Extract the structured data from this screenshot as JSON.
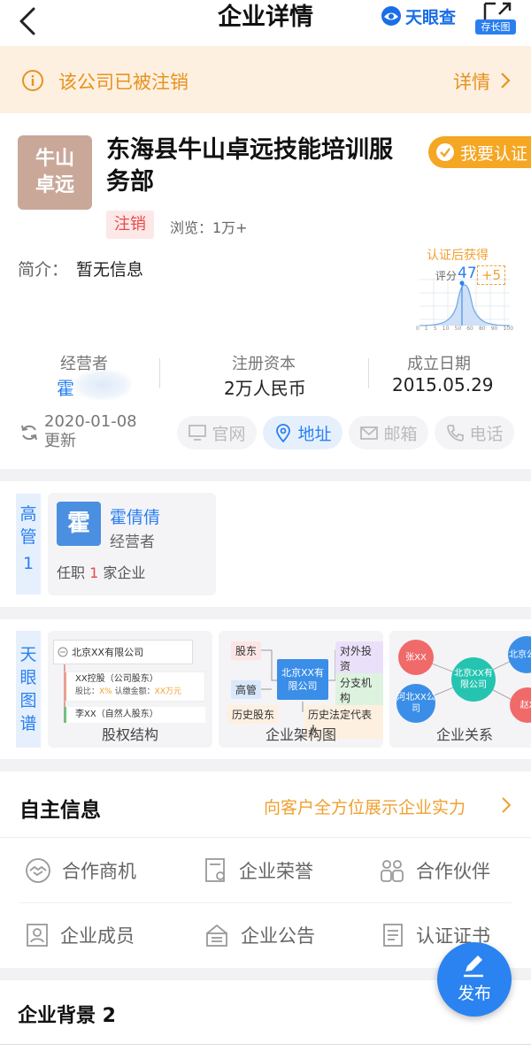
{
  "header": {
    "title": "企业详情",
    "brand": "天眼查",
    "long_image_label": "存长图"
  },
  "banner": {
    "text": "该公司已被注销",
    "link": "详情"
  },
  "company": {
    "logo_line1": "牛山",
    "logo_line2": "卓远",
    "name": "东海县牛山卓远技能培训服务部",
    "cert_button": "我要认证",
    "status": "注销",
    "views": "浏览：1万+",
    "intro_label": "简介：",
    "intro_value": "暂无信息"
  },
  "score_widget": {
    "head": "认证后获得",
    "label": "评分",
    "value": "47",
    "plus": "+5",
    "ticks": [
      "0",
      "1",
      "5",
      "10",
      "50",
      "60",
      "80",
      "90",
      "100"
    ]
  },
  "stats": {
    "operator_label": "经营者",
    "operator_value": "霍",
    "capital_label": "注册资本",
    "capital_value": "2万人民币",
    "date_label": "成立日期",
    "date_value": "2015.05.29"
  },
  "update": {
    "date": "2020-01-08",
    "label": "更新"
  },
  "contacts": {
    "website": "官网",
    "address": "地址",
    "email": "邮箱",
    "phone": "电话"
  },
  "executives": {
    "tag": "高管",
    "count": "1",
    "avatar": "霍",
    "name": "霍倩倩",
    "role": "经营者",
    "post_prefix": "任职",
    "post_count": "1",
    "post_suffix": "家企业"
  },
  "graphs": {
    "tag": "天眼图谱",
    "equity": {
      "label": "股权结构",
      "company": "北京XX有限公司",
      "holder1": "XX控股（公司股东）",
      "ratio_label": "股比：",
      "ratio_value": "X%",
      "paid_label": "认缴金额：",
      "paid_value": "XX万元",
      "holder2": "李XX（自然人股东）"
    },
    "structure": {
      "label": "企业架构图",
      "shareholder": "股东",
      "executive": "高管",
      "center": "北京XX有限公司",
      "investment": "对外投资",
      "branch": "分支机构",
      "hist_shareholder": "历史股东",
      "hist_legal": "历史法定代表人"
    },
    "relation": {
      "label": "企业关系",
      "zhang": "张XX",
      "center": "北京XX有限公司",
      "hebei": "河北XX公司",
      "beijing": "北京公司",
      "zhao": "赵X"
    }
  },
  "self_info": {
    "title": "自主信息",
    "link": "向客户全方位展示企业实力",
    "items": [
      "合作商机",
      "企业荣誉",
      "合作伙伴",
      "企业成员",
      "企业公告",
      "认证证书"
    ]
  },
  "fab": {
    "label": "发布"
  },
  "background": {
    "title": "企业背景 2"
  }
}
